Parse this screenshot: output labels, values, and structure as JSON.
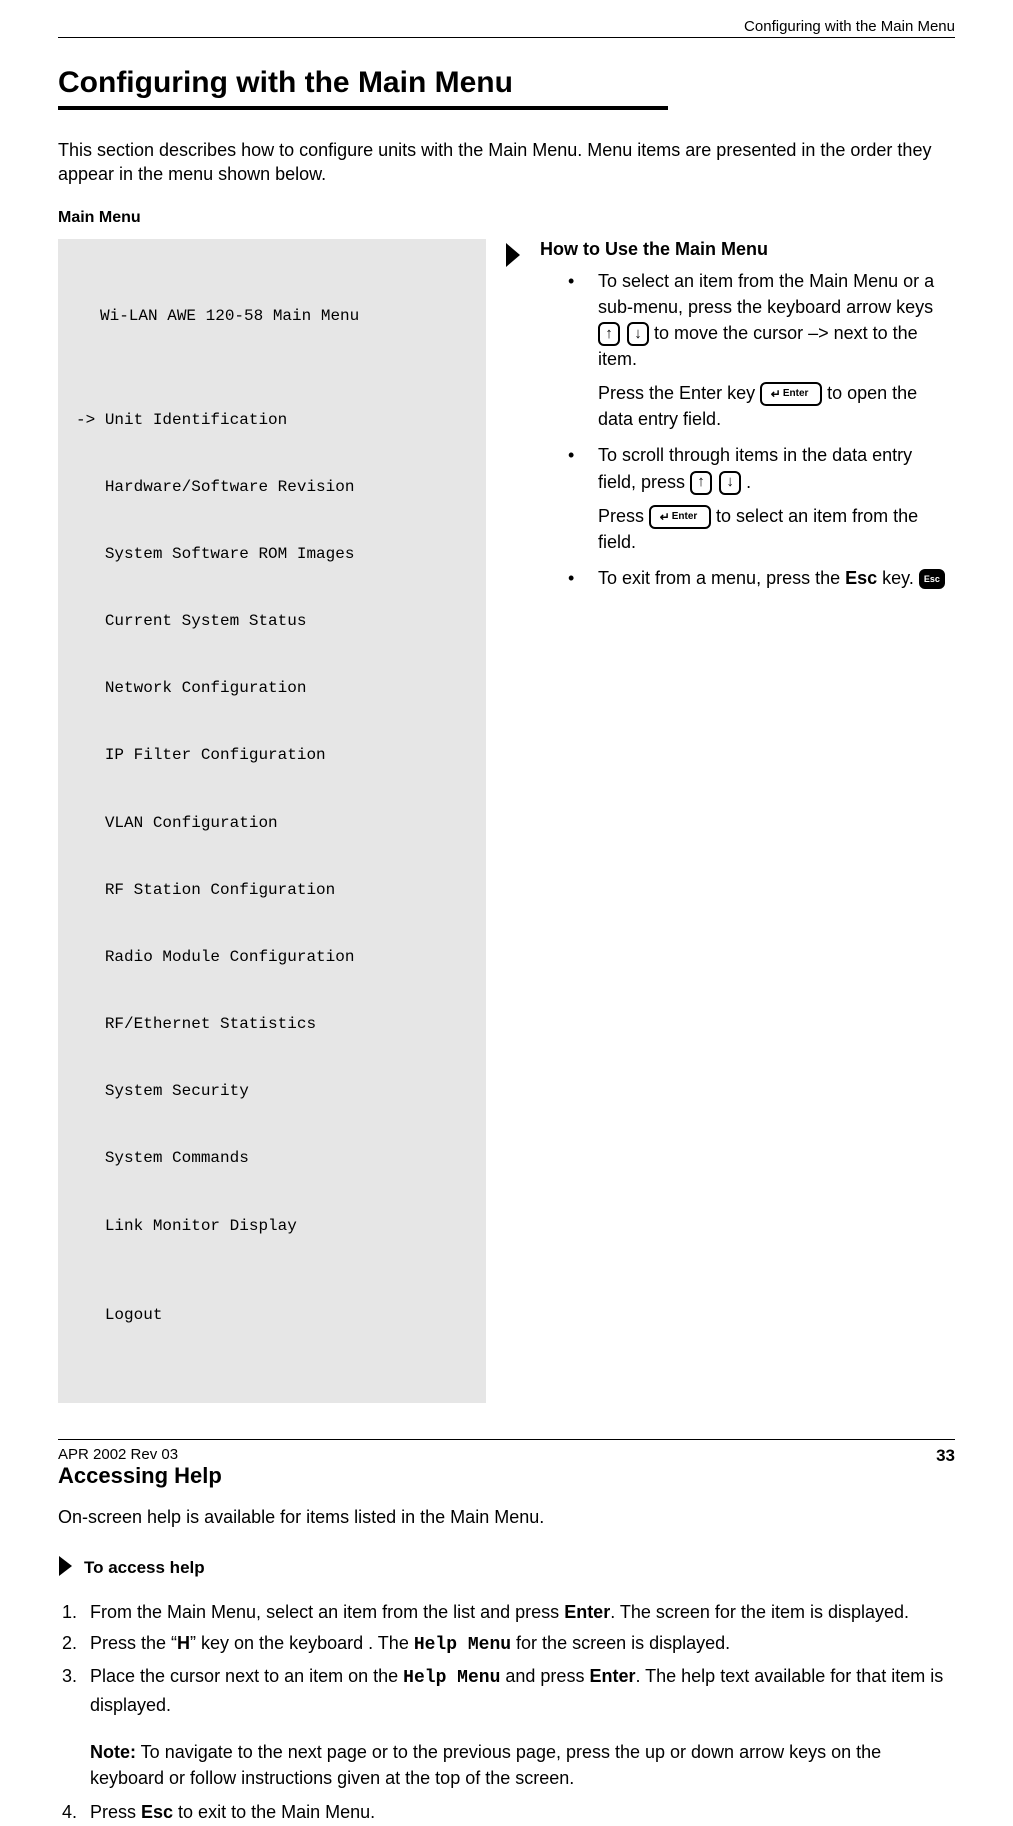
{
  "header": {
    "running": "Configuring with the Main Menu"
  },
  "title": "Configuring with the Main Menu",
  "intro": "This section describes how to configure units with the Main Menu. Menu items are presented in the order they appear in the menu shown below.",
  "main_menu_label": "Main Menu",
  "terminal": {
    "title": "Wi-LAN AWE 120-58 Main Menu",
    "cursor": "->",
    "items": [
      "Unit Identification",
      "Hardware/Software Revision",
      "System Software ROM Images",
      "Current System Status",
      "Network Configuration",
      "IP Filter Configuration",
      "VLAN Configuration",
      "RF Station Configuration",
      "Radio Module Configuration",
      "RF/Ethernet Statistics",
      "System Security",
      "System Commands",
      "Link Monitor Display"
    ],
    "logout": "Logout"
  },
  "howto": {
    "title": "How to Use the Main Menu",
    "b1a": "To select an item from the Main Menu or a sub-menu, press the keyboard arrow keys ",
    "b1b": " to move the cursor –> next to the item.",
    "b1c_pre": "Press the ",
    "b1c_enter": "Enter",
    "b1c_mid": " key ",
    "b1c_post": " to open the data entry field.",
    "b2a": "To scroll through items in the data entry field, press ",
    "b2a_end": " .",
    "b2b_pre": "Press ",
    "b2b_post": " to select an item from the field.",
    "b3a": "To exit from a menu, press the ",
    "b3_esc": "Esc",
    "b3b": " key. "
  },
  "keys": {
    "up": "↑",
    "down": "↓",
    "enter_label": "Enter",
    "enter_arrow": "↵",
    "esc_label": "Esc"
  },
  "help": {
    "heading": "Accessing Help",
    "intro": "On-screen help is available for items listed in the Main Menu.",
    "step_header": "To access help",
    "s1_a": "From the Main Menu, select an item from the list and press ",
    "s1_enter": "Enter",
    "s1_b": ". The screen for the item is displayed.",
    "s2_a": "Press the “",
    "s2_h": "H",
    "s2_b": "” key on the keyboard . The ",
    "s2_help_menu": "Help Menu",
    "s2_c": " for the screen is displayed.",
    "s3_a": "Place the cursor next to an item on the ",
    "s3_help_menu": "Help Menu",
    "s3_b": " and press ",
    "s3_enter": "Enter",
    "s3_c": ". The help text available for that item is displayed.",
    "note_label": "Note:",
    "note_body": " To navigate to the next page or to the previous page, press the up or down arrow keys on the keyboard or follow instructions given at the top of the screen.",
    "s4_a": " Press ",
    "s4_esc": "Esc",
    "s4_b": " to exit to the Main Menu."
  },
  "footer": {
    "left": "APR 2002 Rev 03",
    "page": "33"
  }
}
